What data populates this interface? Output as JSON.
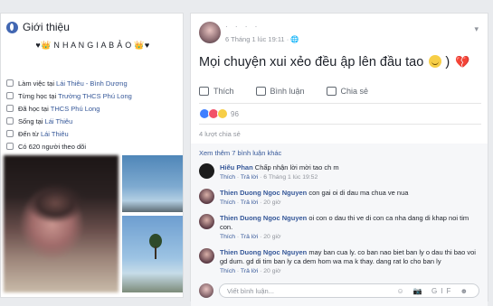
{
  "intro": {
    "title": "Giới thiệu",
    "bio": "♥👑 N H A N G I A B Ả O 👑♥",
    "items": [
      {
        "icon": "briefcase-icon",
        "prefix": "Làm việc tại",
        "link": "Lái Thiêu - Bình Dương"
      },
      {
        "icon": "school-icon",
        "prefix": "Từng học tại",
        "link": "Trường THCS Phú Long"
      },
      {
        "icon": "graduation-icon",
        "prefix": "Đã học tại",
        "link": "THCS Phú Long"
      },
      {
        "icon": "home-icon",
        "prefix": "Sống tại",
        "link": "Lái Thiêu"
      },
      {
        "icon": "location-icon",
        "prefix": "Đến từ",
        "link": "Lái Thiêu"
      },
      {
        "icon": "rss-icon",
        "prefix": "Có 620 người theo dõi",
        "link": ""
      }
    ]
  },
  "post": {
    "author": "· · · ·",
    "time": "6 Tháng 1 lúc 19:11 · 🌐",
    "text": "Mọi chuyện xui xẻo đều ập lên đầu tao",
    "text_tail": ")",
    "actions": {
      "like": "Thích",
      "comment": "Bình luận",
      "share": "Chia sẻ"
    },
    "reaction_count": "96",
    "shares": "4 lượt chia sẻ",
    "more_comments": "Xem thêm 7 bình luận khác",
    "comments": [
      {
        "name": "Hiếu Phan",
        "text": "Chấp nhận lời mời tao ch m",
        "like": "Thích",
        "reply": "Trả lời",
        "time": "6 Tháng 1 lúc 19:52"
      },
      {
        "name": "Thien Duong Ngoc Nguyen",
        "text": "con gai oi di dau ma chua ve nua",
        "like": "Thích",
        "reply": "Trả lời",
        "time": "20 giờ"
      },
      {
        "name": "Thien Duong Ngoc Nguyen",
        "text": "oi con o dau thi ve di con ca nha dang di khap noi tim con.",
        "like": "Thích",
        "reply": "Trả lời",
        "time": "20 giờ"
      },
      {
        "name": "Thien Duong Ngoc Nguyen",
        "text": "may ban cua ly. co ban nao biet ban ly o dau thi bao voi gd dum. gd di tim ban ly ca dem hom wa ma k thay. dang rat lo cho ban ly",
        "like": "Thích",
        "reply": "Trả lời",
        "time": "20 giờ"
      }
    ],
    "write_placeholder": "Viết bình luận...",
    "write_icons": "☺ 📷 GIF ☻"
  },
  "colors": {
    "link": "#365899",
    "fb_blue": "#4267b2",
    "bg": "#e9ebee"
  }
}
